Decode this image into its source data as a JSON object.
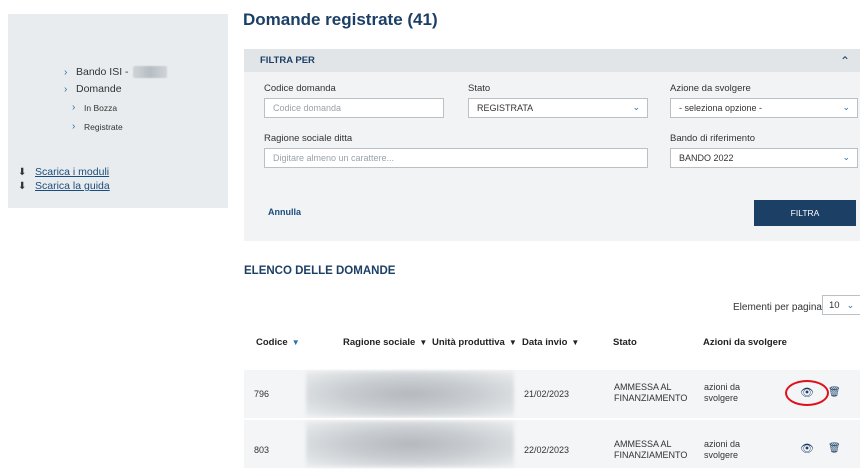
{
  "sidebar": {
    "items": [
      {
        "label": "Bando ISI -"
      },
      {
        "label": "Domande"
      },
      {
        "label": "In Bozza"
      },
      {
        "label": "Registrate"
      }
    ],
    "downloads": [
      {
        "label": "Scarica i moduli"
      },
      {
        "label": "Scarica la guida"
      }
    ]
  },
  "page": {
    "title": "Domande registrate (41)"
  },
  "filter": {
    "title": "FILTRA PER",
    "codice_label": "Codice domanda",
    "codice_placeholder": "Codice domanda",
    "stato_label": "Stato",
    "stato_value": "REGISTRATA",
    "azione_label": "Azione da svolgere",
    "azione_value": "- seleziona opzione -",
    "ragione_label": "Ragione sociale ditta",
    "ragione_placeholder": "Digitare almeno un carattere...",
    "bando_label": "Bando di riferimento",
    "bando_value": "BANDO 2022",
    "annulla": "Annulla",
    "filtra": "FILTRA"
  },
  "list": {
    "title": "ELENCO DELLE DOMANDE",
    "per_page_label": "Elementi per pagina",
    "per_page_value": "10",
    "columns": [
      "Codice",
      "Ragione sociale",
      "Unità produttiva",
      "Data invio",
      "Stato",
      "Azioni da svolgere"
    ],
    "rows": [
      {
        "codice": "796",
        "data": "21/02/2023",
        "stato1": "AMMESSA AL",
        "stato2": "FINANZIAMENTO",
        "azioni1": "azioni da",
        "azioni2": "svolgere"
      },
      {
        "codice": "803",
        "data": "22/02/2023",
        "stato1": "AMMESSA AL",
        "stato2": "FINANZIAMENTO",
        "azioni1": "azioni da",
        "azioni2": "svolgere"
      }
    ]
  },
  "colors": {
    "primary": "#1c3f66",
    "accent": "#2a6fa8",
    "highlight": "#e0101a"
  },
  "icons": [
    "chevron-right-icon",
    "download-icon",
    "chevron-up-icon",
    "chevron-down-icon",
    "sort-down-icon",
    "eye-icon",
    "trash-icon"
  ]
}
